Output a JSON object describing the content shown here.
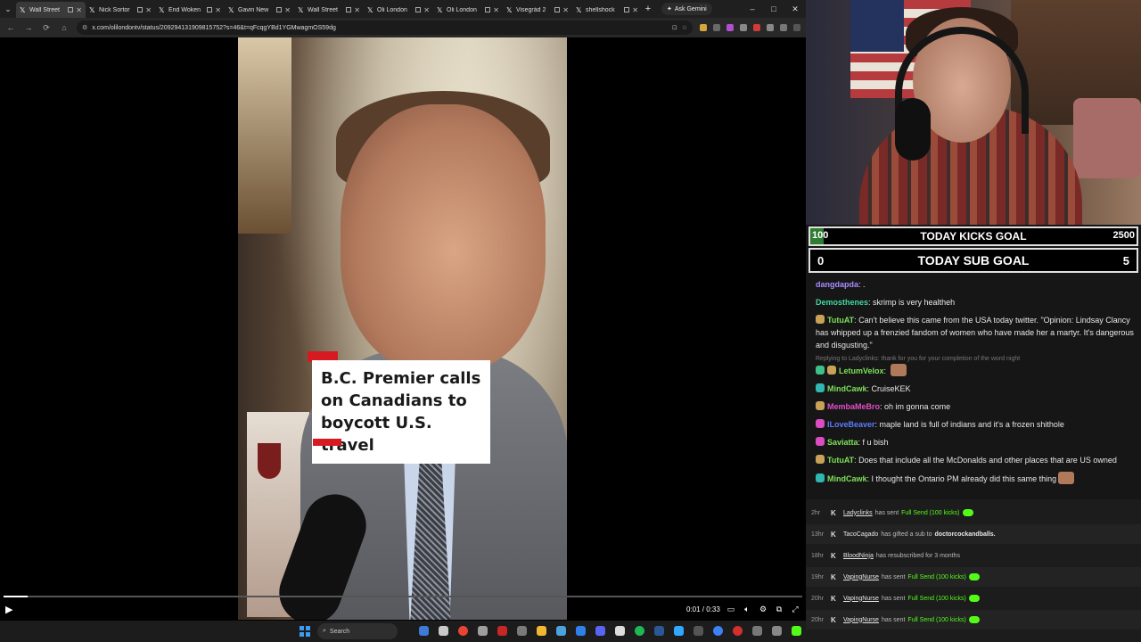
{
  "browser": {
    "tabs": [
      {
        "label": "Wall Street"
      },
      {
        "label": "Nick Sortor"
      },
      {
        "label": "End Woken"
      },
      {
        "label": "Gavin New"
      },
      {
        "label": "Wall Street"
      },
      {
        "label": "Oli London"
      },
      {
        "label": "Oli London"
      },
      {
        "label": "Visegrád 2"
      },
      {
        "label": "shellshock"
      }
    ],
    "gemini_label": "Ask Gemini",
    "url": "x.com/olilondontv/status/209294131909815752?s=46&t=qFcqgYBd1YGMwagmOS59dg"
  },
  "video": {
    "caption_lines": [
      "B.C. Premier calls",
      "on Canadians to",
      "boycott U.S. travel"
    ],
    "time": "0:01 / 0:33",
    "progress": 0.03
  },
  "taskbar": {
    "search_placeholder": "Search"
  },
  "stream": {
    "kicks_goal": {
      "start": "100",
      "label": "TODAY KICKS GOAL",
      "end": "2500",
      "progress": 0.04
    },
    "sub_goal": {
      "start": "0",
      "label": "TODAY SUB GOAL",
      "end": "5"
    },
    "chat": [
      {
        "user": "dangdapda",
        "color": "#a98cff",
        "text": ".",
        "badges": []
      },
      {
        "user": "Demosthenes",
        "color": "#3fd8a0",
        "text": "skrimp is very healtheh",
        "badges": []
      },
      {
        "user": "TutuAT",
        "color": "#7ee05a",
        "text": "Can't believe this came from the USA today twitter. \"Opinion: Lindsay Clancy has whipped up a frenzied fandom of women who have made her a martyr. It's dangerous and disgusting.\"",
        "badges": [
          "#c9a257"
        ]
      },
      {
        "reply": "Replying to Ladyclinks: thank for you for your completion of the word night",
        "user": "LetumVelox",
        "color": "#7ee05a",
        "text": "",
        "badges": [
          "#3fbf8a",
          "#c9a257"
        ],
        "emote": true
      },
      {
        "user": "MindCawk",
        "color": "#7ee05a",
        "text": "CruiseKEK",
        "badges": [
          "#2fb7b0"
        ]
      },
      {
        "user": "MembaMeBro",
        "color": "#e24ec8",
        "text": "oh im gonna come",
        "badges": [
          "#c9a257"
        ]
      },
      {
        "user": "ILoveBeaver",
        "color": "#5b7cff",
        "text": "maple land is full of indians and it's a frozen shithole",
        "badges": [
          "#d94cc2"
        ]
      },
      {
        "user": "Saviatta",
        "color": "#7ee05a",
        "text": "f u bish",
        "badges": [
          "#d94cc2"
        ]
      },
      {
        "user": "TutuAT",
        "color": "#7ee05a",
        "text": "Does that include all the McDonalds and other places that are US owned",
        "badges": [
          "#c9a257"
        ]
      },
      {
        "user": "MindCawk",
        "color": "#7ee05a",
        "text": "I thought the Ontario PM already did this same thing",
        "badges": [
          "#2fb7b0"
        ],
        "emote": true
      }
    ],
    "events": [
      {
        "age": "2hr",
        "name": "Ladyclinks",
        "link": true,
        "action": "has sent",
        "highlight": "Full Send (100 kicks)",
        "coin": true
      },
      {
        "age": "13hr",
        "name": "TacoCagado",
        "link": false,
        "action": "has gifted a sub to",
        "bold": "doctorcockandballs."
      },
      {
        "age": "18hr",
        "name": "BloodNinja",
        "link": true,
        "action": "has resubscribed for 3 months"
      },
      {
        "age": "19hr",
        "name": "VapingNurse",
        "link": true,
        "action": "has sent",
        "highlight": "Full Send (100 kicks)",
        "coin": true
      },
      {
        "age": "20hr",
        "name": "VapingNurse",
        "link": true,
        "action": "has sent",
        "highlight": "Full Send (100 kicks)",
        "coin": true
      },
      {
        "age": "20hr",
        "name": "VapingNurse",
        "link": true,
        "action": "has sent",
        "highlight": "Full Send (100 kicks)",
        "coin": true
      }
    ]
  }
}
